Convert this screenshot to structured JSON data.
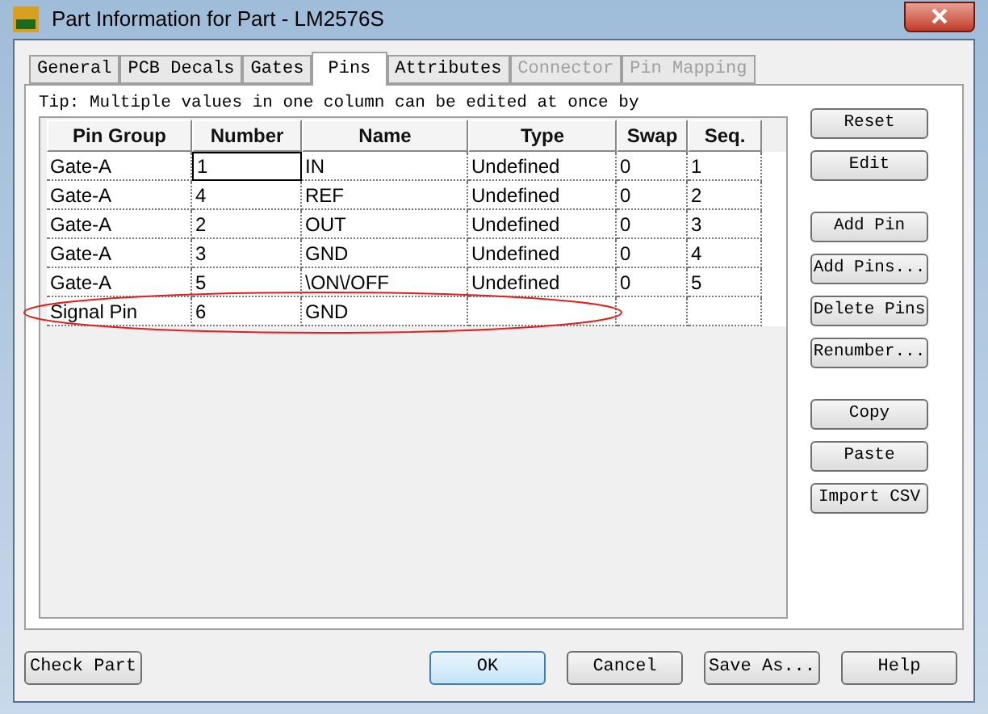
{
  "window": {
    "title": "Part Information for Part - LM2576S"
  },
  "tabs": [
    {
      "label": "General",
      "selected": false,
      "disabled": false
    },
    {
      "label": "PCB Decals",
      "selected": false,
      "disabled": false
    },
    {
      "label": "Gates",
      "selected": false,
      "disabled": false
    },
    {
      "label": "Pins",
      "selected": true,
      "disabled": false
    },
    {
      "label": "Attributes",
      "selected": false,
      "disabled": false
    },
    {
      "label": "Connector",
      "selected": false,
      "disabled": true
    },
    {
      "label": "Pin Mapping",
      "selected": false,
      "disabled": true
    }
  ],
  "tip": "Tip: Multiple values in one column can be edited at once by",
  "table": {
    "columns": [
      "Pin Group",
      "Number",
      "Name",
      "Type",
      "Swap",
      "Seq."
    ],
    "rows": [
      {
        "cells": [
          {
            "text": "Gate-A",
            "focused": false
          },
          {
            "text": "1",
            "focused": true
          },
          {
            "text": "IN",
            "focused": false
          },
          {
            "text": "Undefined",
            "focused": false
          },
          {
            "text": "0",
            "focused": false
          },
          {
            "text": "1",
            "focused": false
          }
        ]
      },
      {
        "cells": [
          {
            "text": "Gate-A",
            "focused": false
          },
          {
            "text": "4",
            "focused": false
          },
          {
            "text": "REF",
            "focused": false
          },
          {
            "text": "Undefined",
            "focused": false
          },
          {
            "text": "0",
            "focused": false
          },
          {
            "text": "2",
            "focused": false
          }
        ]
      },
      {
        "cells": [
          {
            "text": "Gate-A",
            "focused": false
          },
          {
            "text": "2",
            "focused": false
          },
          {
            "text": "OUT",
            "focused": false
          },
          {
            "text": "Undefined",
            "focused": false
          },
          {
            "text": "0",
            "focused": false
          },
          {
            "text": "3",
            "focused": false
          }
        ]
      },
      {
        "cells": [
          {
            "text": "Gate-A",
            "focused": false
          },
          {
            "text": "3",
            "focused": false
          },
          {
            "text": "GND",
            "focused": false
          },
          {
            "text": "Undefined",
            "focused": false
          },
          {
            "text": "0",
            "focused": false
          },
          {
            "text": "4",
            "focused": false
          }
        ]
      },
      {
        "cells": [
          {
            "text": "Gate-A",
            "focused": false
          },
          {
            "text": "5",
            "focused": false
          },
          {
            "text": "\\ON\\/OFF",
            "focused": false
          },
          {
            "text": "Undefined",
            "focused": false
          },
          {
            "text": "0",
            "focused": false
          },
          {
            "text": "5",
            "focused": false
          }
        ]
      },
      {
        "cells": [
          {
            "text": "Signal Pin",
            "focused": false
          },
          {
            "text": "6",
            "focused": false
          },
          {
            "text": "GND",
            "focused": false
          },
          {
            "text": "",
            "focused": false
          },
          {
            "text": "",
            "focused": false
          },
          {
            "text": "",
            "focused": false
          }
        ],
        "highlighted": true
      }
    ]
  },
  "side_button_groups": [
    [
      "Reset",
      "Edit"
    ],
    [
      "Add Pin",
      "Add Pins...",
      "Delete Pins",
      "Renumber..."
    ],
    [
      "Copy",
      "Paste",
      "Import CSV"
    ]
  ],
  "bottom_left_button": "Check Part",
  "bottom_buttons": [
    {
      "label": "OK",
      "default": true
    },
    {
      "label": "Cancel",
      "default": false
    },
    {
      "label": "Save As...",
      "default": false
    },
    {
      "label": "Help",
      "default": false
    }
  ]
}
